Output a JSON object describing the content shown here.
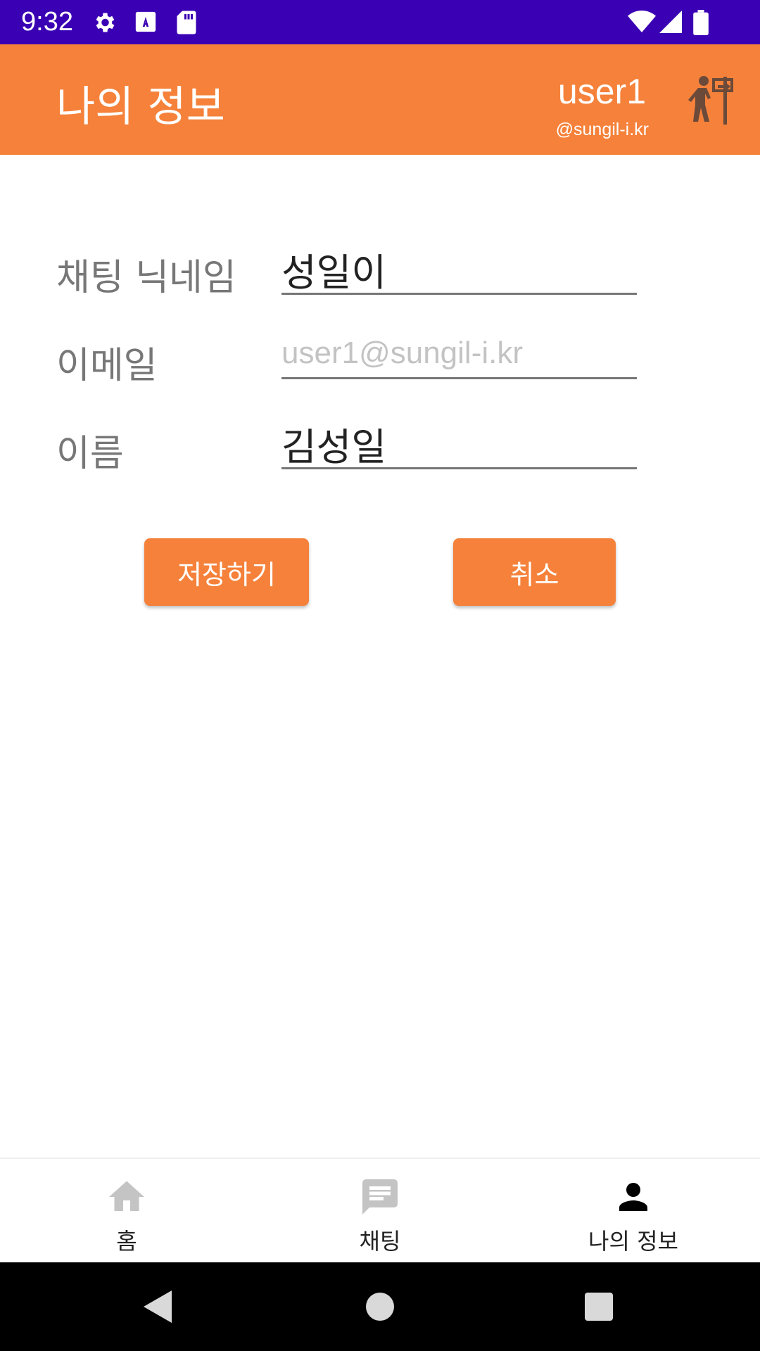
{
  "status_bar": {
    "time": "9:32",
    "left_icons": [
      "gear-icon",
      "font-download-icon",
      "sd-card-icon"
    ],
    "right_icons": [
      "wifi-icon",
      "signal-icon",
      "battery-icon"
    ],
    "background": "#3a00b4"
  },
  "app_bar": {
    "title": "나의 정보",
    "user_name": "user1",
    "user_email": "@sungil-i.kr",
    "action_icon": "logout-exit-icon",
    "background": "#f5813a"
  },
  "form": {
    "nickname_label": "채팅 닉네임",
    "nickname_value": "성일이",
    "email_label": "이메일",
    "email_value": "user1@sungil-i.kr",
    "name_label": "이름",
    "name_value": "김성일"
  },
  "buttons": {
    "save_label": "저장하기",
    "cancel_label": "취소"
  },
  "bottom_nav": {
    "items": [
      {
        "label": "홈",
        "icon": "home-icon",
        "active": false
      },
      {
        "label": "채팅",
        "icon": "chat-icon",
        "active": false
      },
      {
        "label": "나의 정보",
        "icon": "person-icon",
        "active": true
      }
    ]
  },
  "system_nav": {
    "icons": [
      "back-icon",
      "home-circle-icon",
      "recents-icon"
    ]
  },
  "colors": {
    "accent": "#f5813a",
    "status_bar": "#3a00b4",
    "inactive_icon": "#c4c4c4",
    "active_icon": "#000000"
  }
}
